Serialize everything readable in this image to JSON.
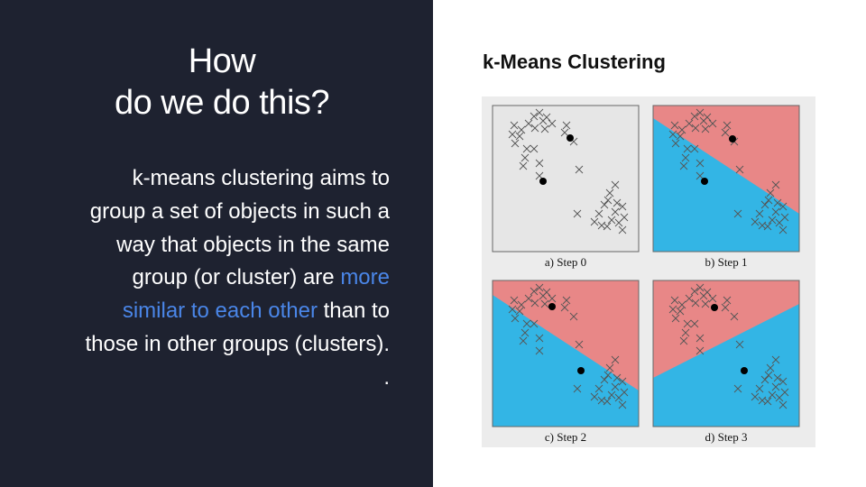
{
  "left": {
    "heading_line1": "How",
    "heading_line2": "do we do this?",
    "body": {
      "line1": "k-means clustering aims to",
      "line2": "group a set of objects in such a",
      "line3": "way that objects in the same",
      "line4_pre": "group (or cluster) are ",
      "line4_highlight": "more",
      "line5_highlight": "similar to each other",
      "line5_post": " than to",
      "line6": "those in other groups (clusters).",
      "line7": "."
    },
    "highlight_color": "#4a86e8",
    "background_color": "#1e2230"
  },
  "right": {
    "title": "k-Means Clustering"
  },
  "diagram": {
    "colors": {
      "red_region": "#e88787",
      "blue_region": "#33b5e5",
      "step0_bg": "#e6e6e6",
      "marker": "#555555",
      "centroid": "#000000"
    },
    "panels": [
      {
        "caption": "a) Step 0"
      },
      {
        "caption": "b) Step 1"
      },
      {
        "caption": "c) Step 2"
      },
      {
        "caption": "d) Step 3"
      }
    ]
  }
}
